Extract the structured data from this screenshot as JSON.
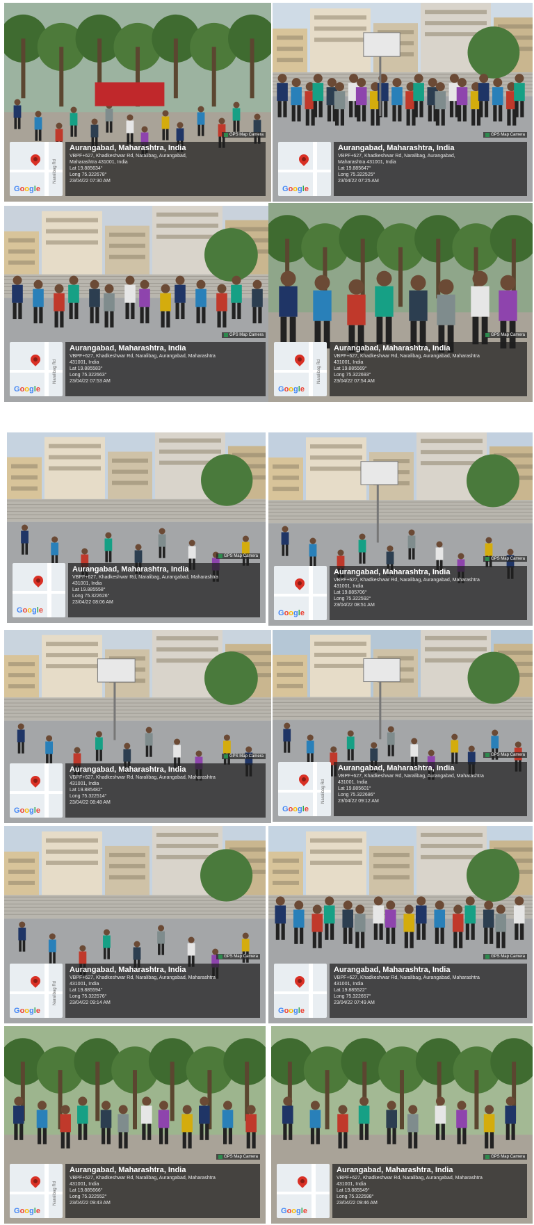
{
  "photos": [
    {
      "title": "Aurangabad, Maharashtra, India",
      "lines": [
        "VBPF+627, Khadkeshwar Rd, Naralibag, Aurangabad,",
        "Maharashtra 431001, India",
        "Lat 19.885634°",
        "Long 75.322678°",
        "23/04/22 07:30 AM"
      ],
      "badge": "GPS Map Camera",
      "road": "Naralibag Rd"
    },
    {
      "title": "Aurangabad, Maharashtra, India",
      "lines": [
        "VBPF+627, Khadkeshwar Rd, Naralibag, Aurangabad,",
        "Maharashtra 431001, India",
        "Lat 19.885647°",
        "Long 75.322525°",
        "23/04/22 07:25 AM"
      ],
      "badge": "GPS Map Camera",
      "road": ""
    },
    {
      "title": "Aurangabad, Maharashtra, India",
      "lines": [
        "VBPF+627, Khadkeshwar Rd, Naralibag, Aurangabad, Maharashtra",
        "431001, India",
        "Lat 19.885583°",
        "Long 75.322663°",
        "23/04/22 07:53 AM"
      ],
      "badge": "GPS Map Camera",
      "road": "Naralibag Rd"
    },
    {
      "title": "Aurangabad, Maharashtra, India",
      "lines": [
        "VBPF+627, Khadkeshwar Rd, Naralibag, Aurangabad, Maharashtra",
        "431001, India",
        "Lat 19.885569°",
        "Long 75.322693°",
        "23/04/22 07:54 AM"
      ],
      "badge": "GPS Map Camera",
      "road": "Naralibag Rd"
    },
    {
      "title": "Aurangabad, Maharashtra, India",
      "lines": [
        "VBPF+627, Khadkeshwar Rd, Naralibag, Aurangabad, Maharashtra",
        "431001, India",
        "Lat 19.885558°",
        "Long 75.322626°",
        "23/04/22 08:06 AM"
      ],
      "badge": "GPS Map Camera",
      "road": ""
    },
    {
      "title": "Aurangabad, Maharashtra, India",
      "lines": [
        "VBPF+627, Khadkeshwar Rd, Naralibag, Aurangabad, Maharashtra",
        "431001, India",
        "Lat 19.885706°",
        "Long 75.322592°",
        "23/04/22 08:51 AM"
      ],
      "badge": "GPS Map Camera",
      "road": ""
    },
    {
      "title": "Aurangabad, Maharashtra, India",
      "lines": [
        "VBPF+627, Khadkeshwar Rd, Naralibag, Aurangabad, Maharashtra",
        "431001, India",
        "Lat 19.885482°",
        "Long 75.322514°",
        "23/04/22 08:48 AM"
      ],
      "badge": "GPS Map Camera",
      "road": ""
    },
    {
      "title": "Aurangabad, Maharashtra, India",
      "lines": [
        "VBPF+627, Khadkeshwar Rd, Naralibag, Aurangabad, Maharashtra",
        "431001, India",
        "Lat 19.885601°",
        "Long 75.322686°",
        "23/04/22 09:12 AM"
      ],
      "badge": "GPS Map Camera",
      "road": "Naralibag Rd"
    },
    {
      "title": "Aurangabad, Maharashtra, India",
      "lines": [
        "VBPF+627, Khadkeshwar Rd, Naralibag, Aurangabad, Maharashtra",
        "431001, India",
        "Lat 19.885594°",
        "Long 75.322576°",
        "23/04/22 09:14 AM"
      ],
      "badge": "GPS Map Camera",
      "road": "Naralibag Rd"
    },
    {
      "title": "Aurangabad, Maharashtra, India",
      "lines": [
        "VBPF+627, Khadkeshwar Rd, Naralibag, Aurangabad, Maharashtra",
        "431001, India",
        "Lat 19.885522°",
        "Long 75.322657°",
        "23/04/22 07:49 AM"
      ],
      "badge": "GPS Map Camera",
      "road": ""
    },
    {
      "title": "Aurangabad, Maharashtra, India",
      "lines": [
        "VBPF+627, Khadkeshwar Rd, Naralibag, Aurangabad, Maharashtra",
        "431001, India",
        "Lat 19.885666°",
        "Long 75.322552°",
        "23/04/22 09:43 AM"
      ],
      "badge": "GPS Map Camera",
      "road": "Naralibag Rd"
    },
    {
      "title": "Aurangabad, Maharashtra, India",
      "lines": [
        "VBPF+627, Khadkeshwar Rd, Naralibag, Aurangabad, Maharashtra",
        "431001, India",
        "Lat 19.885549°",
        "Long 75.322598°",
        "23/04/22 09:46 AM"
      ],
      "badge": "GPS Map Camera",
      "road": ""
    }
  ],
  "map_logo": "Google"
}
